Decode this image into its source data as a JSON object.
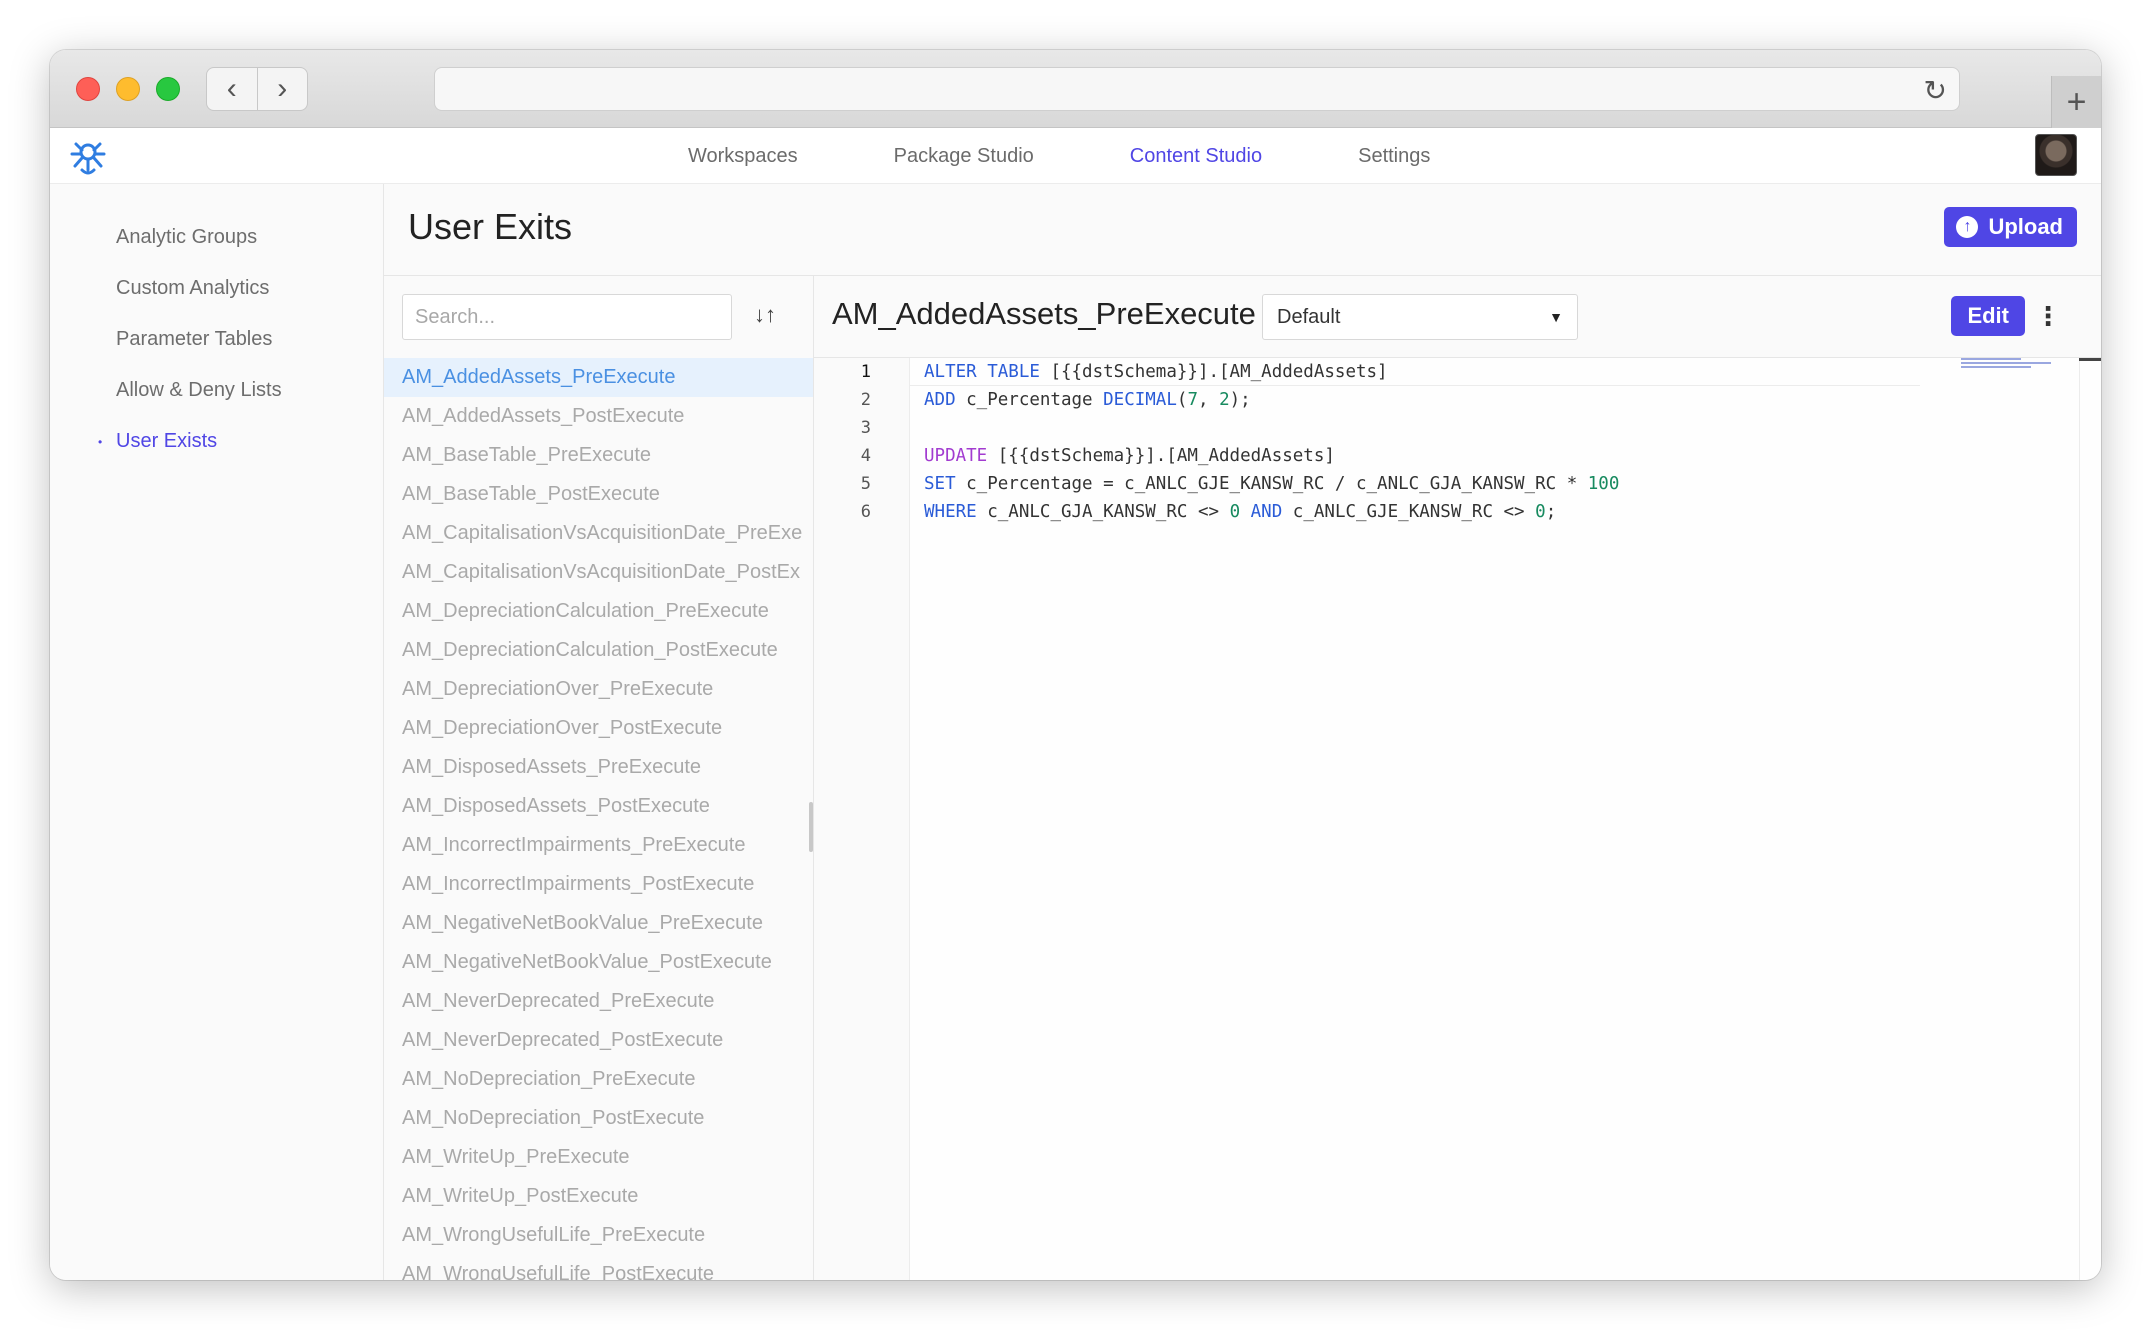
{
  "browser": {
    "back_icon": "chevron-left-icon",
    "forward_icon": "chevron-right-icon",
    "reload_icon": "reload-icon",
    "newtab_icon": "plus-icon",
    "url": ""
  },
  "topnav": {
    "links": [
      {
        "label": "Workspaces",
        "active": false
      },
      {
        "label": "Package Studio",
        "active": false
      },
      {
        "label": "Content Studio",
        "active": true
      },
      {
        "label": "Settings",
        "active": false
      }
    ],
    "accent_color": "#5046e5"
  },
  "sidebar": {
    "items": [
      {
        "label": "Analytic Groups",
        "active": false
      },
      {
        "label": "Custom Analytics",
        "active": false
      },
      {
        "label": "Parameter Tables",
        "active": false
      },
      {
        "label": "Allow & Deny Lists",
        "active": false
      },
      {
        "label": "User Exists",
        "active": true
      }
    ]
  },
  "page": {
    "title": "User Exits",
    "upload_label": "Upload"
  },
  "list": {
    "search_placeholder": "Search...",
    "items": [
      "AM_AddedAssets_PreExecute",
      "AM_AddedAssets_PostExecute",
      "AM_BaseTable_PreExecute",
      "AM_BaseTable_PostExecute",
      "AM_CapitalisationVsAcquisitionDate_PreExe",
      "AM_CapitalisationVsAcquisitionDate_PostEx",
      "AM_DepreciationCalculation_PreExecute",
      "AM_DepreciationCalculation_PostExecute",
      "AM_DepreciationOver_PreExecute",
      "AM_DepreciationOver_PostExecute",
      "AM_DisposedAssets_PreExecute",
      "AM_DisposedAssets_PostExecute",
      "AM_IncorrectImpairments_PreExecute",
      "AM_IncorrectImpairments_PostExecute",
      "AM_NegativeNetBookValue_PreExecute",
      "AM_NegativeNetBookValue_PostExecute",
      "AM_NeverDeprecated_PreExecute",
      "AM_NeverDeprecated_PostExecute",
      "AM_NoDepreciation_PreExecute",
      "AM_NoDepreciation_PostExecute",
      "AM_WriteUp_PreExecute",
      "AM_WriteUp_PostExecute",
      "AM_WrongUsefulLife_PreExecute",
      "AM_WrongUsefulLife_PostExecute"
    ],
    "selected_index": 0
  },
  "editor": {
    "file_title": "AM_AddedAssets_PreExecute",
    "variant": "Default",
    "edit_label": "Edit",
    "line_numbers": [
      "1",
      "2",
      "3",
      "4",
      "5",
      "6"
    ],
    "lines": [
      [
        {
          "t": "ALTER TABLE",
          "c": "kw"
        },
        {
          "t": " [{{dstSchema}}].[AM_AddedAssets]",
          "c": ""
        }
      ],
      [
        {
          "t": "ADD",
          "c": "kw"
        },
        {
          "t": " c_Percentage ",
          "c": ""
        },
        {
          "t": "DECIMAL",
          "c": "kw"
        },
        {
          "t": "(",
          "c": ""
        },
        {
          "t": "7",
          "c": "num"
        },
        {
          "t": ", ",
          "c": ""
        },
        {
          "t": "2",
          "c": "num"
        },
        {
          "t": ");",
          "c": ""
        }
      ],
      [],
      [
        {
          "t": "UPDATE",
          "c": "kw2"
        },
        {
          "t": " [{{dstSchema}}].[AM_AddedAssets]",
          "c": ""
        }
      ],
      [
        {
          "t": "SET",
          "c": "kw"
        },
        {
          "t": " c_Percentage = c_ANLC_GJE_KANSW_RC / c_ANLC_GJA_KANSW_RC * ",
          "c": ""
        },
        {
          "t": "100",
          "c": "num"
        }
      ],
      [
        {
          "t": "WHERE",
          "c": "kw"
        },
        {
          "t": " c_ANLC_GJA_KANSW_RC <> ",
          "c": ""
        },
        {
          "t": "0",
          "c": "num"
        },
        {
          "t": " AND",
          "c": "kw"
        },
        {
          "t": " c_ANLC_GJE_KANSW_RC <> ",
          "c": ""
        },
        {
          "t": "0",
          "c": "num"
        },
        {
          "t": ";",
          "c": ""
        }
      ]
    ]
  }
}
